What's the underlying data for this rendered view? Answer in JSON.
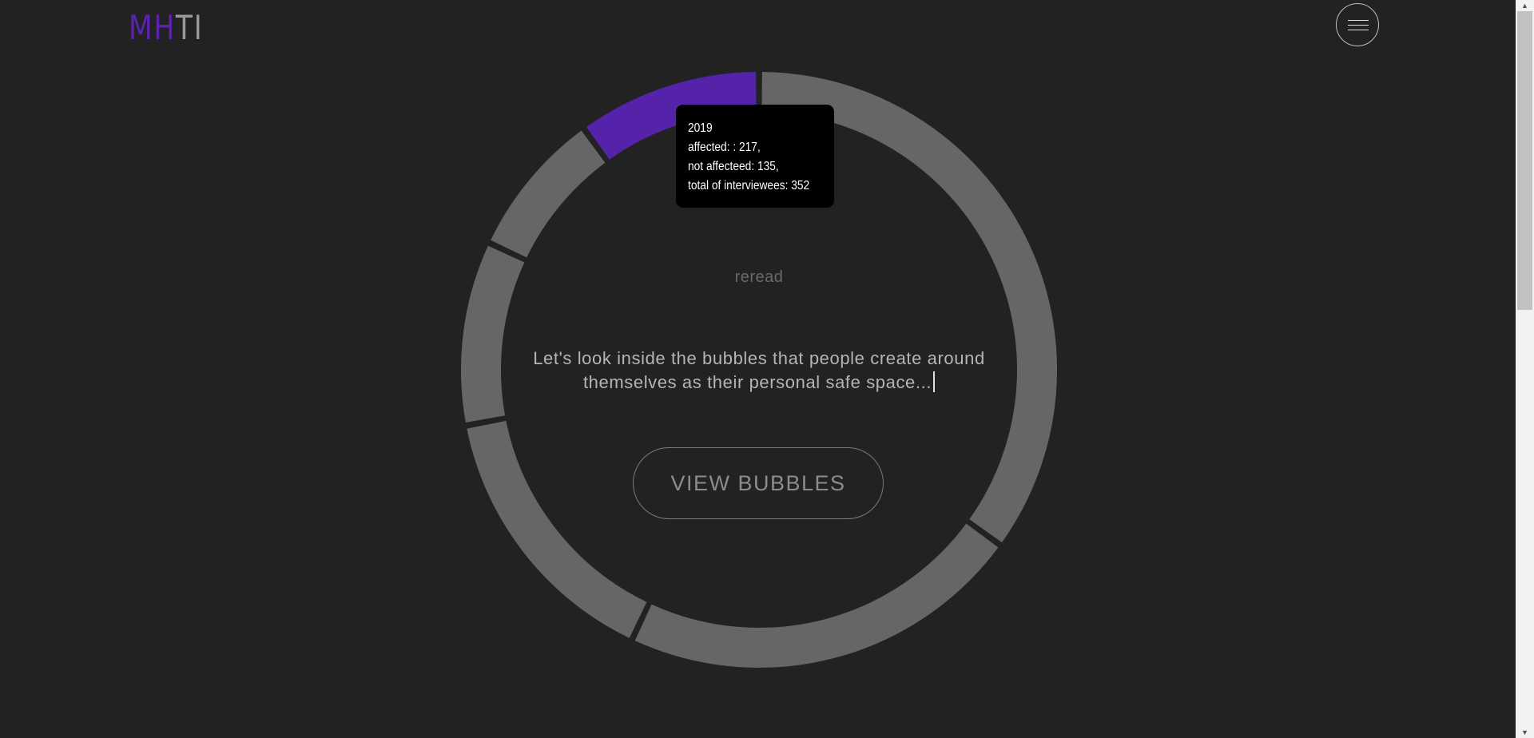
{
  "header": {
    "logo_part1": "MH",
    "logo_part2": "TI",
    "menu_icon": "hamburger-menu-icon"
  },
  "chart_data": {
    "type": "pie",
    "style": "donut",
    "segments": [
      {
        "value": 35,
        "color": "#666666"
      },
      {
        "value": 22,
        "color": "#666666"
      },
      {
        "value": 15,
        "color": "#666666"
      },
      {
        "value": 10,
        "color": "#666666"
      },
      {
        "value": 8,
        "color": "#666666"
      },
      {
        "value": 10,
        "color": "#5522aa",
        "highlighted": true
      }
    ],
    "tooltip": {
      "year": "2019",
      "affected": "affected: : 217,",
      "not_affected": "not affecteed: 135,",
      "total": "total of interviewees: 352"
    }
  },
  "main": {
    "reread_label": "reread",
    "intro_text": "Let's look inside the bubbles that people create around themselves as their personal safe space...",
    "view_button_label": "VIEW BUBBLES"
  },
  "colors": {
    "background": "#222222",
    "accent": "#5522aa",
    "ring": "#666666"
  }
}
